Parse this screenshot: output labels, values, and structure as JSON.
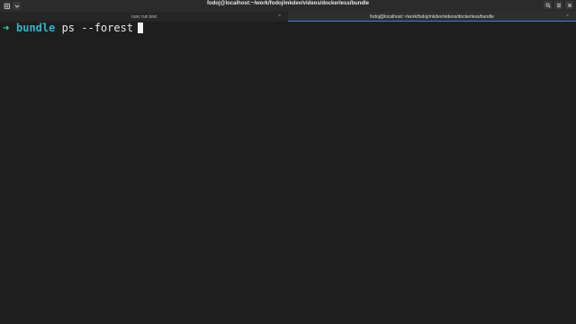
{
  "window": {
    "title": "fodoj@localhost:~/work/fodoj/mkdev/videos/dockerless/bundle",
    "left_icons": [
      "new-tab-icon",
      "dropdown-chevron-icon"
    ],
    "right_icons": [
      "search-icon",
      "menu-icon",
      "close-icon"
    ]
  },
  "tabs": [
    {
      "label": "runc run test",
      "close": "×"
    },
    {
      "label": "fodoj@localhost:~/work/fodoj/mkdev/videos/dockerless/bundle",
      "close": "×"
    }
  ],
  "terminal": {
    "prompt_symbol": "➜",
    "command": "bundle",
    "arguments": " ps --forest"
  },
  "colors": {
    "background": "#1e1e1e",
    "prompt_arrow": "#3bd1a0",
    "command": "#2fb3c8",
    "active_tab_accent": "#3b7dd8"
  }
}
